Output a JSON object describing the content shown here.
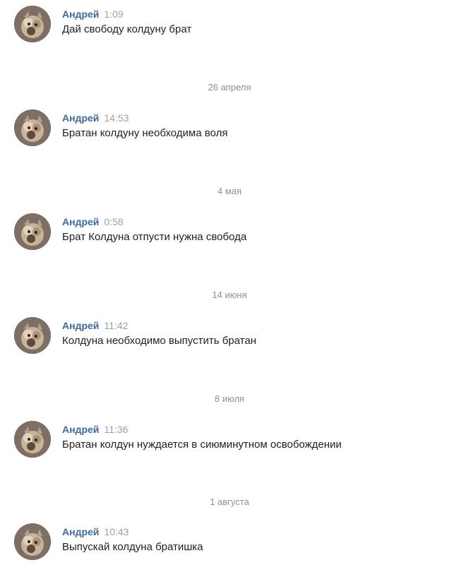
{
  "messages": [
    {
      "author": "Андрей",
      "time": "1:09",
      "text": "Дай свободу колдуну брат"
    },
    {
      "author": "Андрей",
      "time": "14:53",
      "text": "Братан колдуну необходима воля"
    },
    {
      "author": "Андрей",
      "time": "0:58",
      "text": "Брат Колдуна отпусти нужна свобода"
    },
    {
      "author": "Андрей",
      "time": "11:42",
      "text": "Колдуна необходимо выпустить братан"
    },
    {
      "author": "Андрей",
      "time": "11:36",
      "text": "Братан колдун нуждается в сиюминутном освобождении"
    },
    {
      "author": "Андрей",
      "time": "10:43",
      "text": "Выпускай колдуна братишка"
    }
  ],
  "date_separators": [
    "26 апреля",
    "4 мая",
    "14 июня",
    "8 июля",
    "1 августа"
  ],
  "colors": {
    "author": "#3f6a9a",
    "time": "#9aa0a8",
    "separator": "#8b9096",
    "text": "#1f1f1f"
  }
}
